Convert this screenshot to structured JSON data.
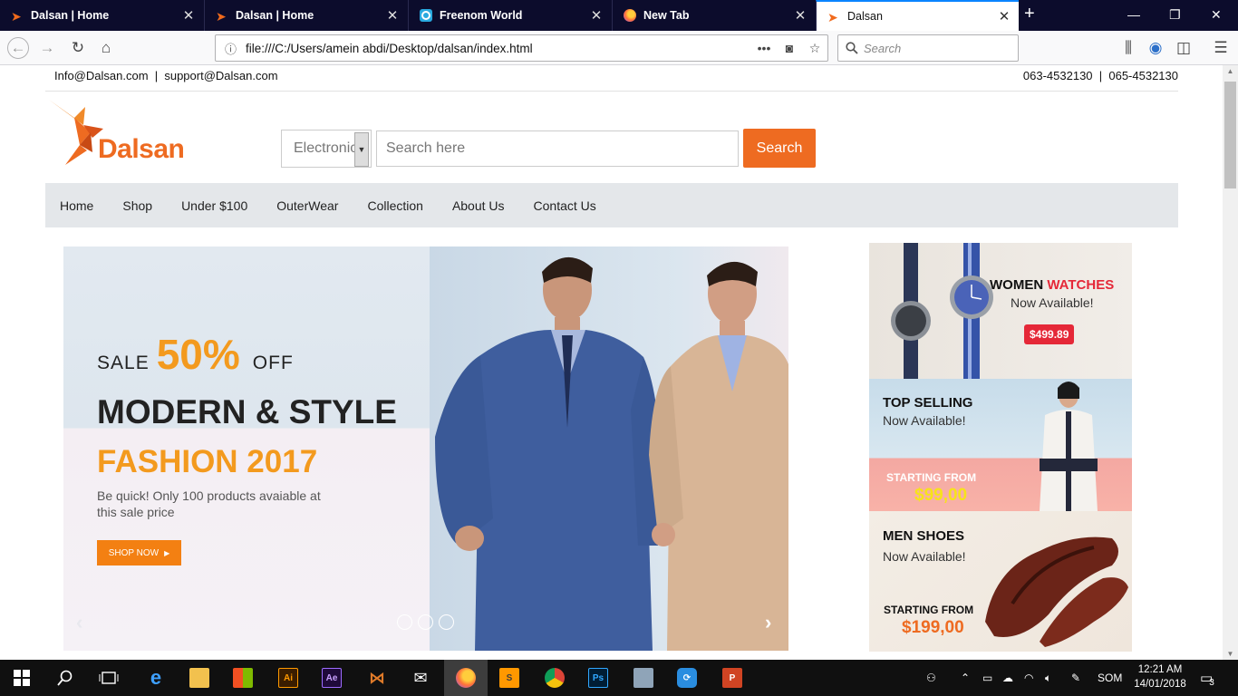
{
  "browser": {
    "tabs": [
      {
        "title": "Dalsan | Home",
        "icon": "dalsan-favicon",
        "active": false
      },
      {
        "title": "Dalsan | Home",
        "icon": "dalsan-favicon",
        "active": false
      },
      {
        "title": "Freenom World",
        "icon": "freenom-favicon",
        "active": false
      },
      {
        "title": "New Tab",
        "icon": "firefox-favicon",
        "active": false
      },
      {
        "title": "Dalsan",
        "icon": "dalsan-favicon",
        "active": true
      }
    ],
    "url": "file:///C:/Users/amein abdi/Desktop/dalsan/index.html",
    "search_placeholder": "Search",
    "accent": "#0a84ff"
  },
  "site": {
    "emails": "Info@Dalsan.com  |  support@Dalsan.com",
    "phones": "063-4532130  |  065-4532130",
    "logo_text": "Dalsan",
    "brand_color": "#ee6b21",
    "search": {
      "category": "Electronics",
      "placeholder": "Search here",
      "button": "Search"
    },
    "menu": [
      "Home",
      "Shop",
      "Under $100",
      "OuterWear",
      "Collection",
      "About Us",
      "Contact Us"
    ],
    "hero": {
      "sale_prefix": "SALE",
      "sale_percent": "50%",
      "sale_suffix": "OFF",
      "headline": "MODERN & STYLE",
      "subheadline": "FASHION 2017",
      "description": "Be quick! Only 100 products avaiable at this sale price",
      "cta": "SHOP NOW",
      "prev_arrow": "‹",
      "next_arrow": "›",
      "slide_count": 3
    },
    "banners": {
      "watches": {
        "title_1": "WOMEN",
        "title_2": "WATCHES",
        "sub": "Now Available!",
        "price": "$499.89"
      },
      "top_selling": {
        "title": "TOP SELLING",
        "sub": "Now Available!",
        "from": "STARTING FROM",
        "price": "$99,00"
      },
      "shoes": {
        "title": "MEN SHOES",
        "sub": "Now Available!",
        "from": "STARTING FROM",
        "price": "$199,00"
      }
    }
  },
  "taskbar": {
    "apps": [
      "start-icon",
      "search-icon",
      "task-view-icon",
      "edge-icon",
      "file-explorer-icon",
      "store-icon",
      "illustrator-icon",
      "after-effects-icon",
      "visual-studio-icon",
      "mail-icon",
      "firefox-icon",
      "sublime-text-icon",
      "chrome-icon",
      "photoshop-icon",
      "network-icon",
      "sync-icon",
      "powerpoint-icon"
    ],
    "illustrator_label": "Ai",
    "after_effects_label": "Ae",
    "photoshop_label": "Ps",
    "powerpoint_label": "P",
    "language": "SOM",
    "time": "12:21 AM",
    "date": "14/01/2018",
    "notifications": "3"
  }
}
